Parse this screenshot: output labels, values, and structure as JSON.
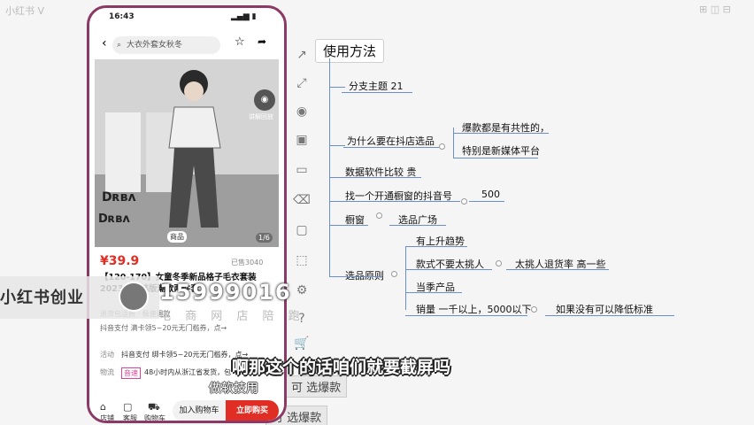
{
  "desktop": {
    "topleft": "小红书 Ⅴ",
    "topright": "⊞ ◫ ⊟"
  },
  "phone": {
    "time": "16:43",
    "search_placeholder": "大衣外套女秋冬",
    "image_button": "讲解回放",
    "image_tag": "商品",
    "image_counter": "1/6",
    "price": "¥39.9",
    "sold": "已售3040",
    "title": "【120-170】女童冬季新品格子毛衣套装2023新款韩版潮款两件套",
    "row_service": "退货包运费 · 极速退款",
    "row_coupon": "抖音支付 满卡领5~20元无门槛券，点→",
    "row_activity_label": "活动",
    "row_activity": "抖音支付  绑卡领5~20元无门槛券，点→",
    "row_logistics_label": "物流",
    "row_logistics_badge": "音速",
    "row_logistics": "48小时内从浙江省发货，包",
    "nav": [
      "店铺",
      "客服",
      "购物车"
    ],
    "cart_label": "加入购物车",
    "buy_label": "立即购买"
  },
  "mindmap": {
    "center_fragment": "使用方法",
    "branch_topic": "分支主题 21",
    "why": "为什么要在抖店选品",
    "why_children": [
      "爆款都是有共性的，",
      "特别是新媒体平台"
    ],
    "data_software": "数据软件比较 贵",
    "find_account": "找一个开通橱窗的抖音号",
    "find_account_value": "500",
    "showcase": "橱窗",
    "showcase_child": "选品广场",
    "principles": "选品原则",
    "principles_children": [
      "有上升趋势",
      "款式不要太挑人",
      "当季产品",
      "销量  一千以上，5000以下"
    ],
    "principle_notes": [
      "太挑人退货率 高一些",
      "如果没有可以降低标准"
    ],
    "ghost1": "可 选爆款",
    "ghost2": "可 选爆款"
  },
  "overlay": {
    "brand": "小红书创业",
    "phone_number": "15999016",
    "sub": "电 商 网 店 陪 跑",
    "caption": "啊那这个的话咱们就要截屏吗",
    "caption2": "做软技用"
  }
}
